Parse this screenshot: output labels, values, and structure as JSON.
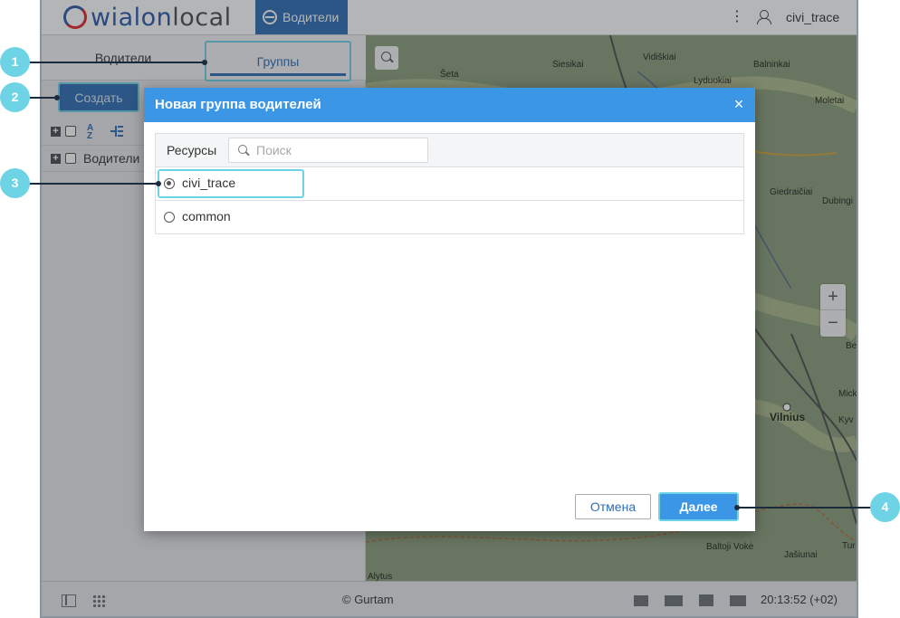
{
  "header": {
    "logo_main": "wialon",
    "logo_suffix": "local",
    "nav_active": "Водители",
    "username": "civi_trace"
  },
  "left_panel": {
    "tabs": [
      {
        "label": "Водители",
        "active": false
      },
      {
        "label": "Группы",
        "active": true
      }
    ],
    "create_button": "Создать",
    "tree_root": "Водители"
  },
  "map": {
    "labels": [
      {
        "text": "Šeta"
      },
      {
        "text": "Siesikai"
      },
      {
        "text": "Vidiškiai"
      },
      {
        "text": "Balninkai"
      },
      {
        "text": "Lyduokiai"
      },
      {
        "text": "Moletai"
      },
      {
        "text": "Giedraičiai"
      },
      {
        "text": "Dubingi"
      },
      {
        "text": "Vilnius"
      },
      {
        "text": "Mick"
      },
      {
        "text": "Kyv"
      },
      {
        "text": "Be"
      },
      {
        "text": "Baltoji Vokė"
      },
      {
        "text": "Jašiunai"
      },
      {
        "text": "Tur"
      },
      {
        "text": "Alytus"
      }
    ],
    "zoom_in": "+",
    "zoom_out": "−"
  },
  "dialog": {
    "title": "Новая группа водителей",
    "close": "×",
    "resources_label": "Ресурсы",
    "search_placeholder": "Поиск",
    "resources": [
      {
        "name": "civi_trace",
        "selected": true
      },
      {
        "name": "common",
        "selected": false
      }
    ],
    "cancel": "Отмена",
    "next": "Далее"
  },
  "footer": {
    "copyright": "© Gurtam",
    "time": "20:13:52 (+02)"
  },
  "callouts": [
    "1",
    "2",
    "3",
    "4"
  ],
  "colors": {
    "accent": "#3b97e6",
    "nav": "#2f6eb3",
    "callout": "#6fd3e6"
  }
}
